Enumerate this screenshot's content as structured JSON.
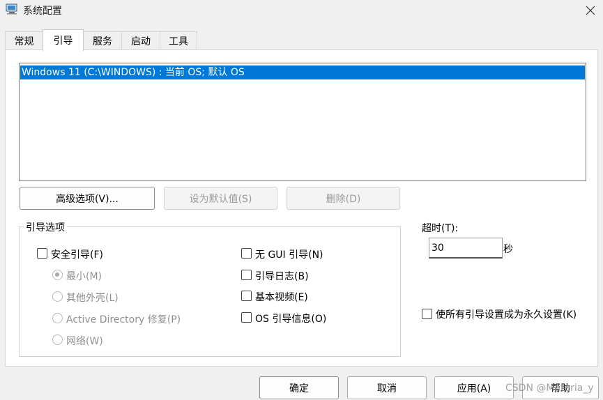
{
  "window": {
    "title": "系统配置"
  },
  "tabs": [
    {
      "label": "常规"
    },
    {
      "label": "引导",
      "active": true
    },
    {
      "label": "服务"
    },
    {
      "label": "启动"
    },
    {
      "label": "工具"
    }
  ],
  "os_list": {
    "items": [
      {
        "label": "Windows 11 (C:\\WINDOWS) : 当前 OS; 默认 OS",
        "selected": true
      }
    ]
  },
  "list_buttons": {
    "advanced": "高级选项(V)...",
    "set_default": "设为默认值(S)",
    "delete": "删除(D)"
  },
  "boot_options": {
    "group_label": "引导选项",
    "safe_boot": {
      "label": "安全引导(F)",
      "checked": false
    },
    "minimal": {
      "label": "最小(M)",
      "checked": true,
      "enabled": false
    },
    "alternate_shell": {
      "label": "其他外壳(L)",
      "checked": false,
      "enabled": false
    },
    "active_directory_repair": {
      "label": "Active Directory 修复(P)",
      "checked": false,
      "enabled": false
    },
    "network": {
      "label": "网络(W)",
      "checked": false,
      "enabled": false
    },
    "no_gui_boot": {
      "label": "无 GUI 引导(N)",
      "checked": false
    },
    "boot_log": {
      "label": "引导日志(B)",
      "checked": false
    },
    "base_video": {
      "label": "基本视频(E)",
      "checked": false
    },
    "os_boot_info": {
      "label": "OS 引导信息(O)",
      "checked": false
    }
  },
  "timeout": {
    "label": "超时(T):",
    "value": "30",
    "unit": "秒"
  },
  "make_permanent": {
    "label": "使所有引导设置成为永久设置(K)",
    "checked": false
  },
  "footer_buttons": {
    "ok": "确定",
    "cancel": "取消",
    "apply": "应用(A)",
    "help": "帮助"
  },
  "watermark": "CSDN @Materia_y",
  "colors": {
    "selection": "#0078d7",
    "window_bg": "#f0f0f0",
    "panel_bg": "#ffffff"
  }
}
